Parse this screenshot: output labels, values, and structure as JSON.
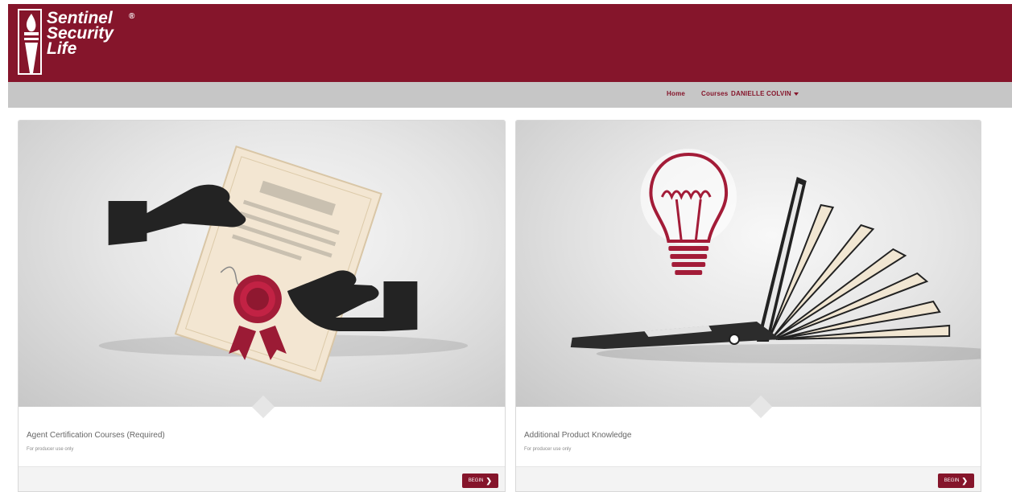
{
  "brand": {
    "line1": "Sentinel",
    "line2": "Security",
    "line3": "Life",
    "registered": "®",
    "color": "#85152b"
  },
  "nav": {
    "home": "Home",
    "courses": "Courses",
    "user": "DANIELLE COLVIN"
  },
  "cards": [
    {
      "title": "Agent Certification Courses (Required)",
      "subtitle": "For producer use only",
      "button": "BEGIN",
      "button_icon": "chevron-right-icon",
      "image": "certificate-handover-illustration"
    },
    {
      "title": "Additional Product Knowledge",
      "subtitle": "For producer use only",
      "button": "BEGIN",
      "button_icon": "chevron-right-icon",
      "image": "lightbulb-laptop-book-illustration"
    }
  ]
}
